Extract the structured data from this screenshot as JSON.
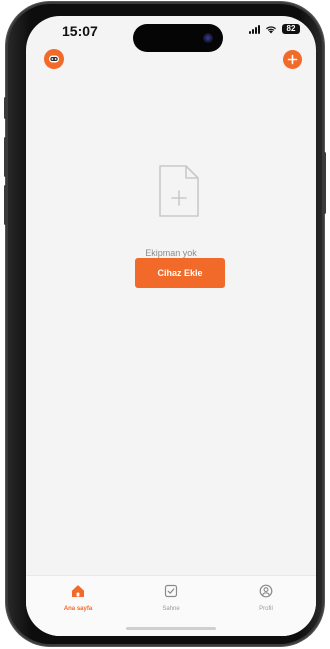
{
  "status_bar": {
    "time": "15:07",
    "battery_level": "82"
  },
  "header": {
    "profile_icon": "robot-avatar-icon",
    "add_icon": "plus-icon",
    "accent_color": "#f26a2a"
  },
  "empty_state": {
    "icon": "document-plus-icon",
    "message": "Ekipman yok",
    "button_label": "Cihaz Ekle"
  },
  "tab_bar": {
    "tabs": [
      {
        "label": "Ana sayfa",
        "icon": "home-icon",
        "active": true
      },
      {
        "label": "Sahne",
        "icon": "checkbox-icon",
        "active": false
      },
      {
        "label": "Profil",
        "icon": "profile-icon",
        "active": false
      }
    ]
  }
}
